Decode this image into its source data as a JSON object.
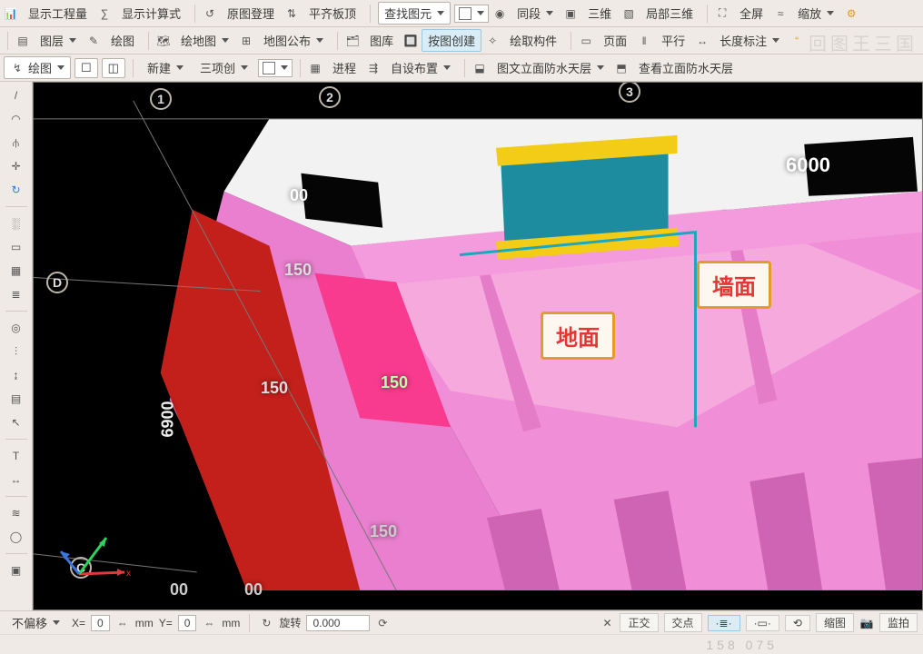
{
  "toolbars": {
    "row1": {
      "b1": "显示工程量",
      "b2": "显示计算式",
      "b3": "原图登理",
      "b4": "平齐板顶",
      "b5": "查找图元",
      "b6": "同段",
      "b7": "三维",
      "b8": "局部三维",
      "b9": "全屏",
      "b10": "缩放"
    },
    "row2": {
      "b1": "图层",
      "b2": "绘图",
      "b3": "绘地图",
      "b4": "地图公布",
      "b5": "图库",
      "b6": "按图创建",
      "b7": "绘取构件",
      "b8": "页面",
      "b9": "平行",
      "b10": "长度标注"
    },
    "row3": {
      "b1": "绘图",
      "b2": "新建",
      "b3": "三项创",
      "b4": "进程",
      "b5": "自设布置",
      "b6": "图文立面防水天层",
      "b7": "查看立面防水天层"
    }
  },
  "side_icons": [
    "line",
    "arc",
    "mirror",
    "cross",
    "c-arc",
    "sep",
    "palette",
    "rect",
    "grid",
    "layers",
    "sep",
    "mag",
    "filter",
    "scale",
    "db",
    "cursor",
    "sep",
    "text",
    "dim",
    "sep",
    "meas",
    "circ",
    "sep",
    "cube"
  ],
  "viewport": {
    "grid_bubbles": {
      "g1": "1",
      "g2": "2",
      "g3": "3",
      "gC": "C",
      "gD": "D"
    },
    "dims": {
      "d1": "150",
      "d2": "150",
      "d3": "150",
      "d4": "150",
      "d5": "6900",
      "d6": "00",
      "d7": "6000",
      "d8": "00",
      "d9": "00"
    },
    "callouts": {
      "floor": "地面",
      "wall": "墙面"
    }
  },
  "status": {
    "s1": "不偏移",
    "x_label": "X=",
    "x_val": "0",
    "x_unit": "mm",
    "y_label": "Y=",
    "y_val": "0",
    "y_unit": "mm",
    "rot_label": "旋转",
    "rot_val": "0.000",
    "btn1": "正交",
    "btn2": "交点",
    "segbtn1": "·",
    "segbtn2": "≡",
    "segbtn3": "·",
    "segbtn4": "·",
    "btn3": "缩图",
    "btn4": "监拍"
  },
  "faint_right": "回图王三国",
  "faint_bottom": "158 075"
}
